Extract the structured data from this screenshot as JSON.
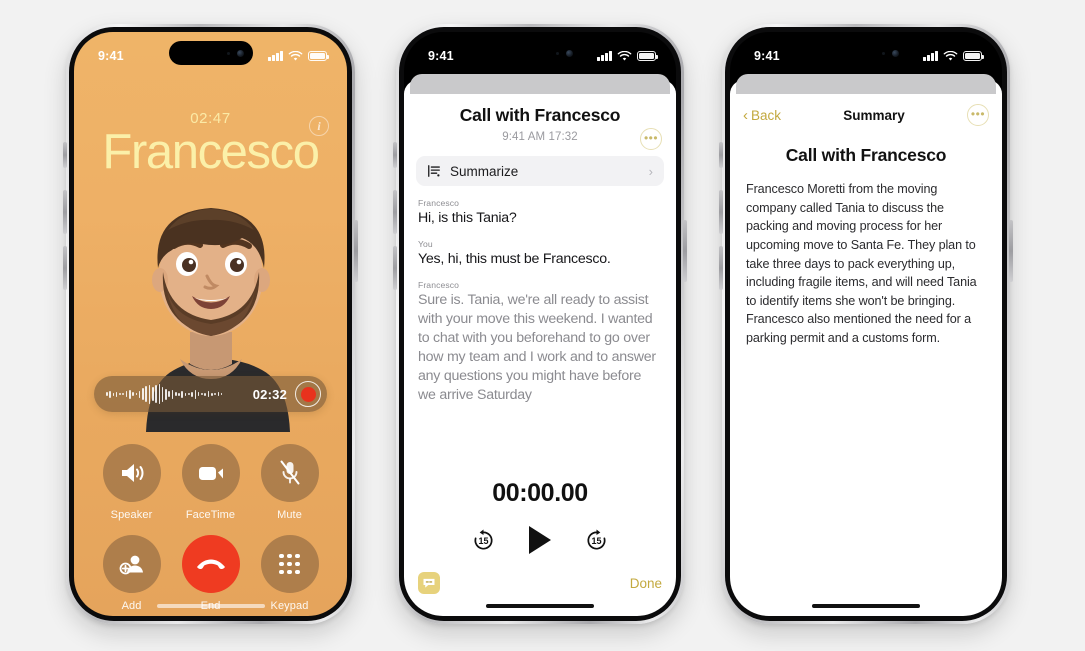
{
  "phone1": {
    "status": {
      "time": "9:41"
    },
    "call_duration": "02:47",
    "contact_name": "Francesco",
    "info_icon": "info-circle-icon",
    "recording": {
      "elapsed": "02:32",
      "record_icon": "record-button-icon",
      "waveform_icon": "audio-waveform-icon"
    },
    "controls": [
      {
        "label": "Speaker",
        "icon": "speaker-icon"
      },
      {
        "label": "FaceTime",
        "icon": "video-camera-icon"
      },
      {
        "label": "Mute",
        "icon": "microphone-muted-icon"
      },
      {
        "label": "Add",
        "icon": "add-person-icon"
      },
      {
        "label": "End",
        "icon": "end-call-icon"
      },
      {
        "label": "Keypad",
        "icon": "keypad-icon"
      }
    ]
  },
  "phone2": {
    "status": {
      "time": "9:41"
    },
    "title": "Call with Francesco",
    "subtitle": "9:41 AM  17:32",
    "more_icon": "more-options-icon",
    "summarize": {
      "label": "Summarize",
      "icon": "summarize-icon",
      "chevron": "chevron-right-icon"
    },
    "transcript": [
      {
        "speaker": "Francesco",
        "text": "Hi, is this Tania?",
        "faded": false
      },
      {
        "speaker": "You",
        "text": "Yes, hi, this must be Francesco.",
        "faded": false
      },
      {
        "speaker": "Francesco",
        "text": "Sure is. Tania, we're all ready to assist with your move this weekend. I wanted to chat with you beforehand to go over how my team and I work and to answer any questions you might have before we arrive Saturday",
        "faded": true
      }
    ],
    "player": {
      "time": "00:00.00",
      "back_label": "15",
      "forward_label": "15",
      "back_icon": "skip-back-15-icon",
      "play_icon": "play-icon",
      "forward_icon": "skip-forward-15-icon"
    },
    "live_transcription_icon": "live-transcription-icon",
    "done_label": "Done"
  },
  "phone3": {
    "status": {
      "time": "9:41"
    },
    "back_label": "Back",
    "back_icon": "chevron-left-icon",
    "nav_title": "Summary",
    "more_icon": "more-options-icon",
    "heading": "Call with Francesco",
    "body": "Francesco Moretti from the moving company called Tania to discuss the packing and moving process for her upcoming move to Santa Fe. They plan to take three days to pack everything up, including fragile items, and will need Tania to identify items she won't be bringing. Francesco also mentioned the need for a parking permit and a customs form."
  },
  "colors": {
    "call_background": "#eeb066",
    "call_name_text": "#fbf0a9",
    "end_call_red": "#ef3b21",
    "accent_gold": "#c3a93f",
    "page_background": "#f2f2f2"
  }
}
